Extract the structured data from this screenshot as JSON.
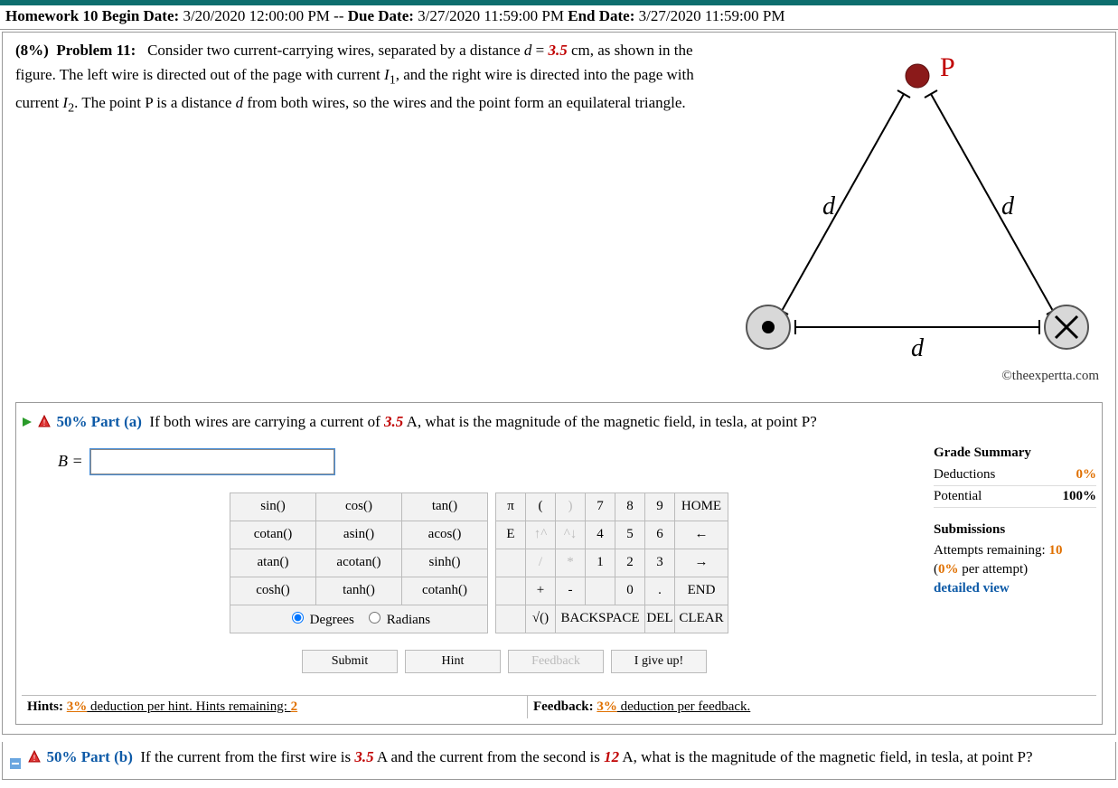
{
  "header": {
    "hw_label": "Homework 10",
    "begin_label": "Begin Date:",
    "begin": "3/20/2020 12:00:00 PM",
    "sep": "--",
    "due_label": "Due Date:",
    "due": "3/27/2020 11:59:00 PM",
    "end_label": "End Date:",
    "end": "3/27/2020 11:59:00 PM"
  },
  "problem": {
    "weight": "(8%)",
    "num_label": "Problem 11:",
    "text_pre": "Consider two current-carrying wires, separated by a distance ",
    "d_var": "d",
    "eq": " = ",
    "d_val": "3.5",
    "text_post1": " cm, as shown in the figure. The left wire is directed out of the page with current ",
    "I1": "I",
    "sub1": "1",
    "text_post2": ", and the right wire is directed into the page with current ",
    "I2": "I",
    "sub2": "2",
    "text_post3": ". The point P is a distance ",
    "d_var2": "d",
    "text_post4": " from both wires, so the wires and the point form an equilateral triangle."
  },
  "figure": {
    "P": "P",
    "d": "d"
  },
  "copyright": "©theexpertta.com",
  "part_a": {
    "pct": "50% Part (a)",
    "q_pre": "If both wires are carrying a current of ",
    "val": "3.5",
    "q_post": " A, what is the magnitude of the magnetic field, in tesla, at point P?",
    "answer_label": "B =",
    "answer_value": ""
  },
  "keypad": {
    "fns": [
      [
        "sin()",
        "cos()",
        "tan()"
      ],
      [
        "cotan()",
        "asin()",
        "acos()"
      ],
      [
        "atan()",
        "acotan()",
        "sinh()"
      ],
      [
        "cosh()",
        "tanh()",
        "cotanh()"
      ]
    ],
    "degrees": "Degrees",
    "radians": "Radians",
    "syms": [
      [
        "π",
        "(",
        ")"
      ],
      [
        "E",
        "↑^",
        "^↓"
      ],
      [
        "",
        "/",
        "*"
      ],
      [
        "",
        "+",
        "-"
      ],
      [
        "",
        "√()",
        ""
      ]
    ],
    "nums": [
      [
        "7",
        "8",
        "9"
      ],
      [
        "4",
        "5",
        "6"
      ],
      [
        "1",
        "2",
        "3"
      ],
      [
        "",
        "0",
        "."
      ]
    ],
    "ctrls": [
      "HOME",
      "←",
      "→",
      "END"
    ],
    "backspace": "BACKSPACE",
    "del": "DEL",
    "clear": "CLEAR"
  },
  "actions": {
    "submit": "Submit",
    "hint": "Hint",
    "feedback": "Feedback",
    "giveup": "I give up!"
  },
  "summary": {
    "title": "Grade Summary",
    "deductions_l": "Deductions",
    "deductions_v": "0%",
    "potential_l": "Potential",
    "potential_v": "100%",
    "subs_title": "Submissions",
    "attempts_l": "Attempts remaining: ",
    "attempts_v": "10",
    "per_l": "(",
    "per_v": "0%",
    "per_r": " per attempt)",
    "detailed": "detailed view"
  },
  "hints_row": {
    "hints_pre": "Hints: ",
    "hints_pct": "3%",
    "hints_mid": " deduction per hint. Hints remaining: ",
    "hints_rem": "2",
    "feedback_pre": "Feedback: ",
    "feedback_pct": "3%",
    "feedback_post": " deduction per feedback."
  },
  "part_b": {
    "pct": "50% Part (b)",
    "q_pre": "If the current from the first wire is ",
    "v1": "3.5",
    "q_mid": " A and the current from the second is ",
    "v2": "12",
    "q_post": " A, what is the magnitude of the magnetic field, in tesla, at point P?"
  }
}
